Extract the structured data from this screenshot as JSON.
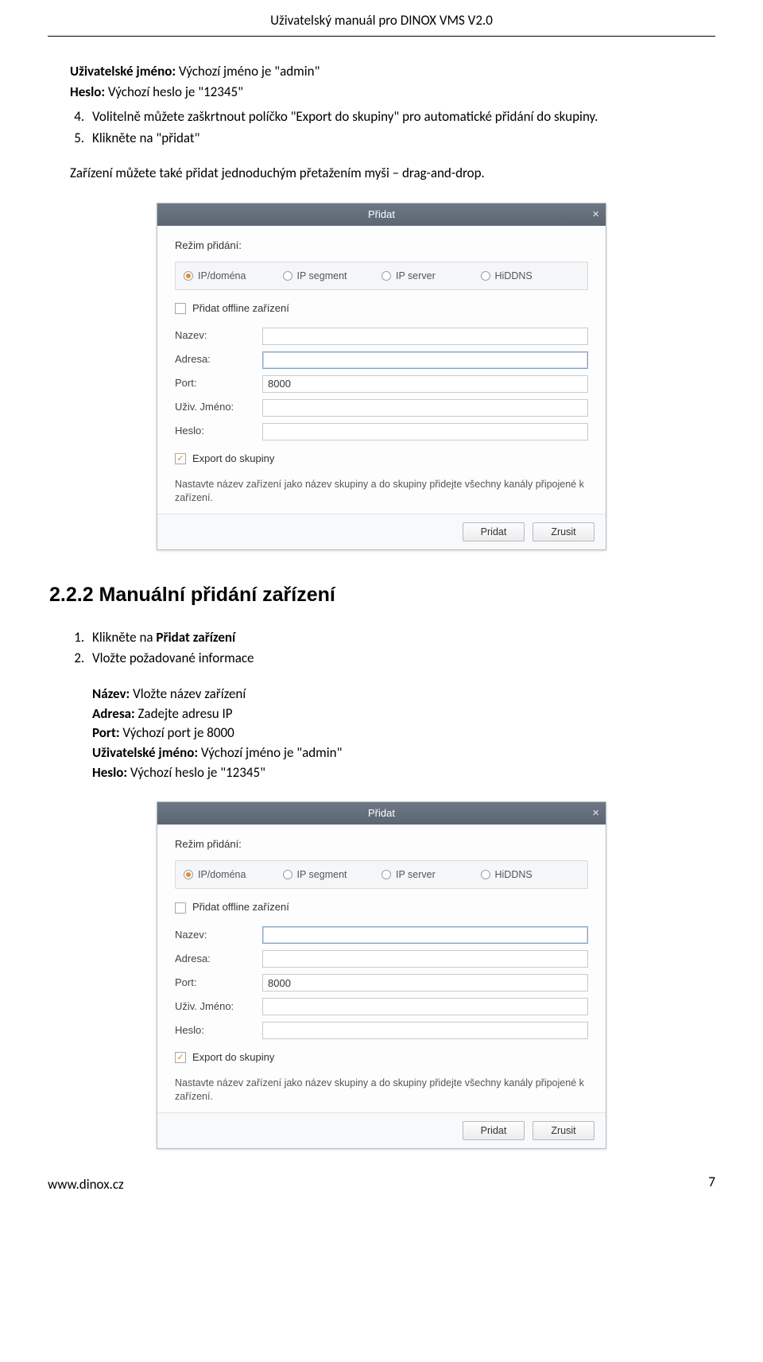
{
  "header": {
    "title": "Uživatelský manuál pro DINOX VMS V2.0"
  },
  "intro": {
    "user_label": "Uživatelské jméno:",
    "user_text": " Výchozí jméno je \"admin\"",
    "pass_label": "Heslo:",
    "pass_text": " Výchozí heslo je \"12345\""
  },
  "steps_a": [
    "Volitelně můžete zaškrtnout políčko \"Export do skupiny\" pro automatické přidání do skupiny.",
    "Klikněte na \"přidat\""
  ],
  "steps_a_start": 4,
  "drag_line": "Zařízení můžete také přidat jednoduchým přetažením myši – drag-and-drop.",
  "dialog1": {
    "title": "Přidat",
    "mode_label": "Režim přidání:",
    "opts": [
      "IP/doména",
      "IP segment",
      "IP server",
      "HiDDNS"
    ],
    "offline_label": "Přidat offline zařízení",
    "rows": {
      "name": "Nazev:",
      "addr": "Adresa:",
      "port": "Port:",
      "port_val": "8000",
      "user": "Uživ. Jméno:",
      "pass": "Heslo:"
    },
    "export_label": "Export do skupiny",
    "hint": "Nastavte název zařízení jako název skupiny a do skupiny přidejte všechny kanály připojené k zařízení.",
    "btn_add": "Pridat",
    "btn_cancel": "Zrusit",
    "focus_field": "addr"
  },
  "section_heading": "2.2.2 Manuální přidání zařízení",
  "steps_b_pre": [
    {
      "text": "Klikněte na ",
      "bold": "Přidat zařízení"
    },
    {
      "text": "Vložte požadované informace"
    }
  ],
  "steps_b_sub": [
    {
      "label": "Název:",
      "text": " Vložte název zařízení"
    },
    {
      "label": "Adresa:",
      "text": " Zadejte adresu IP"
    },
    {
      "label": "Port:",
      "text": " Výchozí port je 8000"
    },
    {
      "label": "Uživatelské jméno:",
      "text": " Výchozí jméno je \"admin\""
    },
    {
      "label": "Heslo:",
      "text": " Výchozí heslo je \"12345\""
    }
  ],
  "dialog2": {
    "title": "Přidat",
    "mode_label": "Režim přidání:",
    "opts": [
      "IP/doména",
      "IP segment",
      "IP server",
      "HiDDNS"
    ],
    "offline_label": "Přidat offline zařízení",
    "rows": {
      "name": "Nazev:",
      "addr": "Adresa:",
      "port": "Port:",
      "port_val": "8000",
      "user": "Uživ. Jméno:",
      "pass": "Heslo:"
    },
    "export_label": "Export do skupiny",
    "hint": "Nastavte název zařízení jako název skupiny a do skupiny přidejte všechny kanály připojené k zařízení.",
    "btn_add": "Pridat",
    "btn_cancel": "Zrusit",
    "focus_field": "name"
  },
  "footer": {
    "url": "www.dinox.cz",
    "page": "7"
  }
}
